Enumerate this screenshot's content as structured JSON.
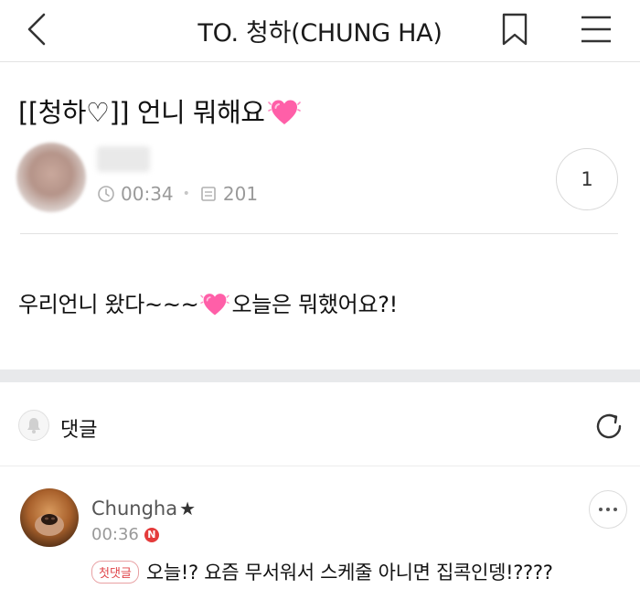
{
  "header": {
    "title": "TO. 청하(CHUNG HA)",
    "back_icon": "chevron-left-icon",
    "bookmark_icon": "bookmark-icon",
    "menu_icon": "hamburger-menu-icon"
  },
  "post": {
    "title": "[[청하♡]] 언니 뭐해요",
    "title_emoji": "sparkling-heart-emoji",
    "author_name": "",
    "time": "00:34",
    "views": "201",
    "comment_count": "1",
    "body_before": "우리언니 왔다~~~",
    "body_emoji": "sparkling-heart-emoji",
    "body_after": "오늘은 뭐했어요?!"
  },
  "comments_section": {
    "label": "댓글",
    "refresh_icon": "refresh-icon",
    "bell_icon": "bell-icon"
  },
  "comments": [
    {
      "author": "Chungha",
      "author_suffix": "★",
      "time": "00:36",
      "new_badge": "N",
      "first_badge": "첫댓글",
      "text": "오늘!? 요즘 무서워서 스케줄 아니면 집콕인뎅!????"
    }
  ],
  "colors": {
    "accent_red": "#e43b3b",
    "divider": "#e2e2e2",
    "band": "#e8e9eb",
    "meta_gray": "#9a9a9a"
  }
}
